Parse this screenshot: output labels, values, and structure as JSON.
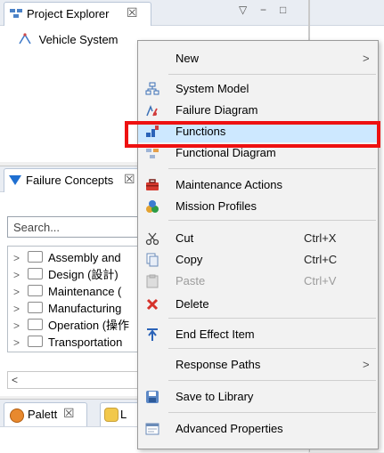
{
  "project_explorer": {
    "tab_label": "Project Explorer",
    "close_glyph": "☒",
    "tree_root": "Vehicle System",
    "controls": [
      "▽",
      "−",
      "□"
    ]
  },
  "failure_concepts": {
    "tab_label": "Failure Concepts",
    "close_glyph": "☒",
    "search_placeholder": "Search...",
    "items": [
      "Assembly and",
      "Design (設計)",
      "Maintenance (",
      "Manufacturing",
      "Operation (操作",
      "Transportation"
    ],
    "scroll_left": "<"
  },
  "palette": {
    "tab_label": "Palett",
    "close_glyph": "☒",
    "lib_tab_label": "L"
  },
  "context_menu": {
    "items": [
      {
        "label": "New",
        "icon": "none",
        "submenu": ">"
      },
      {
        "label": "System Model",
        "icon": "system-model-icon"
      },
      {
        "label": "Failure Diagram",
        "icon": "failure-diagram-icon"
      },
      {
        "label": "Functions",
        "icon": "functions-icon",
        "selected": true
      },
      {
        "label": "Functional Diagram",
        "icon": "functional-diagram-icon"
      },
      {
        "label": "Maintenance Actions",
        "icon": "toolbox-icon"
      },
      {
        "label": "Mission Profiles",
        "icon": "mission-profiles-icon"
      },
      {
        "label": "Cut",
        "icon": "scissors-icon",
        "shortcut": "Ctrl+X"
      },
      {
        "label": "Copy",
        "icon": "copy-icon",
        "shortcut": "Ctrl+C"
      },
      {
        "label": "Paste",
        "icon": "paste-icon",
        "shortcut": "Ctrl+V",
        "disabled": true
      },
      {
        "label": "Delete",
        "icon": "delete-icon"
      },
      {
        "label": "End Effect Item",
        "icon": "end-effect-icon"
      },
      {
        "label": "Response Paths",
        "icon": "none",
        "submenu": ">"
      },
      {
        "label": "Save to Library",
        "icon": "save-icon"
      },
      {
        "label": "Advanced Properties",
        "icon": "properties-icon"
      }
    ]
  },
  "colors": {
    "selection": "#cde8ff",
    "highlight_border": "#e11111",
    "accent_blue": "#1f6fd1"
  }
}
